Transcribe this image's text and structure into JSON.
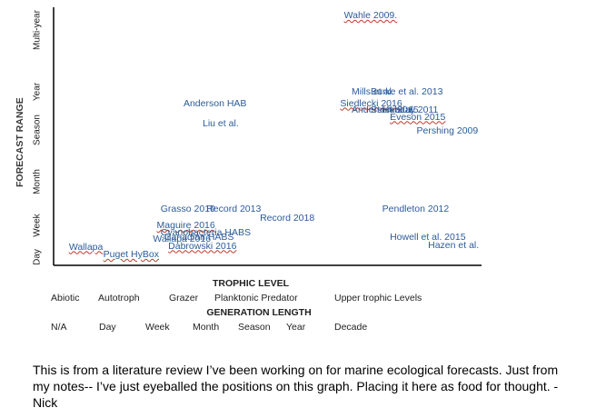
{
  "chart_data": {
    "type": "scatter",
    "title": "",
    "ylabel": "FORECAST RANGE",
    "y_ticks": [
      "Day",
      "Week",
      "Month",
      "Season",
      "Year",
      "Multi-year"
    ],
    "x_labels": [
      {
        "title": "TROPHIC LEVEL",
        "ticks": [
          "Abiotic",
          "Autotroph",
          "Grazer",
          "Planktonic Predator",
          "Upper trophic Levels"
        ]
      },
      {
        "title": "GENERATION LENGTH",
        "ticks": [
          "N/A",
          "Day",
          "Week",
          "Month",
          "Season",
          "Year",
          "Decade"
        ]
      }
    ],
    "grid": false,
    "points": [
      {
        "label": "Wahle 2009.",
        "x": 3.8,
        "y": 5.4
      },
      {
        "label": "Mills et al.",
        "x": 3.9,
        "y": 3.75
      },
      {
        "label": "Burke et al. 2013",
        "x": 4.15,
        "y": 3.75
      },
      {
        "label": "Siedlecki 2016",
        "x": 3.75,
        "y": 3.5
      },
      {
        "label": "Anderson et al.",
        "x": 3.9,
        "y": 3.35
      },
      {
        "label": "Hobday 2011",
        "x": 4.3,
        "y": 3.35
      },
      {
        "label": "Stock 2015",
        "x": 4.15,
        "y": 3.35
      },
      {
        "label": "Eveson 2015",
        "x": 4.4,
        "y": 3.2
      },
      {
        "label": "Pershing 2009",
        "x": 4.75,
        "y": 2.9
      },
      {
        "label": "Anderson HAB",
        "x": 1.7,
        "y": 3.5
      },
      {
        "label": "Liu et al.",
        "x": 1.95,
        "y": 3.05
      },
      {
        "label": "Grasso 2019",
        "x": 1.4,
        "y": 1.2
      },
      {
        "label": "Record 2013",
        "x": 2.0,
        "y": 1.2
      },
      {
        "label": "Record 2018",
        "x": 2.7,
        "y": 1.0
      },
      {
        "label": "Pendleton 2012",
        "x": 4.3,
        "y": 1.2
      },
      {
        "label": "Maguire 2016",
        "x": 1.35,
        "y": 0.85
      },
      {
        "label": "Cyanobacteria HABS",
        "x": 1.4,
        "y": 0.7
      },
      {
        "label": "Wallapa 2016",
        "x": 1.3,
        "y": 0.55
      },
      {
        "label": "Canadian HABS",
        "x": 1.45,
        "y": 0.6
      },
      {
        "label": "Dabrowski 2016",
        "x": 1.5,
        "y": 0.4
      },
      {
        "label": "Wallapa",
        "x": 0.2,
        "y": 0.38
      },
      {
        "label": "Puget HyBox",
        "x": 0.65,
        "y": 0.22
      },
      {
        "label": "Howell et al. 2015",
        "x": 4.4,
        "y": 0.6
      },
      {
        "label": "Hazen et al.",
        "x": 4.9,
        "y": 0.42
      }
    ],
    "xlim": [
      0,
      5.6
    ],
    "ylim": [
      0,
      5.6
    ]
  },
  "caption": "This is from a literature review I’ve been working on for marine ecological forecasts. Just from my notes-- I’ve just eyeballed the positions on this graph. Placing it here as food for thought.  -Nick"
}
